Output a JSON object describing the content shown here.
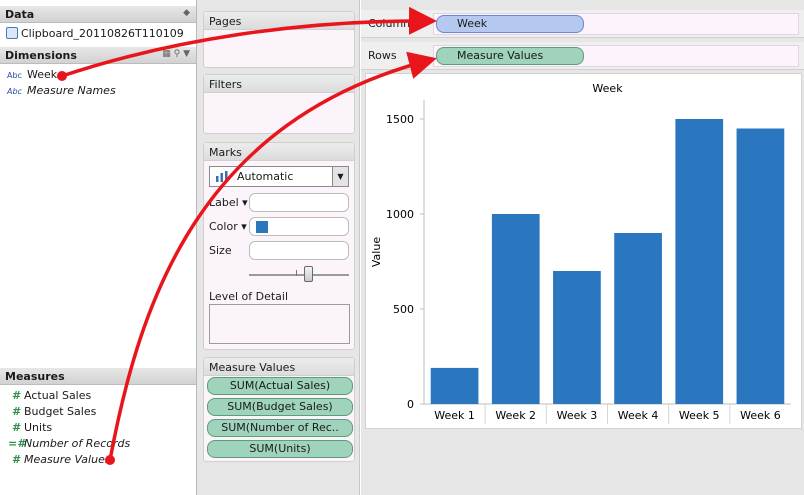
{
  "data_pane": {
    "title": "Data",
    "source_name": "Clipboard_20110826T110109",
    "dimensions_title": "Dimensions",
    "dimensions": [
      {
        "type": "Abc",
        "name": "Week",
        "italic": false
      },
      {
        "type": "Abc",
        "name": "Measure Names",
        "italic": true
      }
    ],
    "measures_title": "Measures",
    "measures": [
      {
        "type": "#",
        "name": "Actual Sales",
        "italic": false
      },
      {
        "type": "#",
        "name": "Budget Sales",
        "italic": false
      },
      {
        "type": "#",
        "name": "Units",
        "italic": false
      },
      {
        "type": "=#",
        "name": "Number of Records",
        "italic": true
      },
      {
        "type": "#",
        "name": "Measure Values",
        "italic": true
      }
    ]
  },
  "shelves": {
    "pages_title": "Pages",
    "filters_title": "Filters",
    "marks_title": "Marks",
    "mark_type": "Automatic",
    "label_label": "Label",
    "color_label": "Color",
    "size_label": "Size",
    "detail_label": "Level of Detail",
    "measure_values_title": "Measure Values",
    "measure_values": [
      "SUM(Actual Sales)",
      "SUM(Budget Sales)",
      "SUM(Number of Rec..",
      "SUM(Units)"
    ],
    "columns_label": "Columns",
    "columns_pill": "Week",
    "rows_label": "Rows",
    "rows_pill": "Measure Values"
  },
  "colors": {
    "bar": "#2a77c0",
    "arrow": "#e8161b",
    "pill_green": "#9fd3bc",
    "pill_blue": "#b4c8f0"
  },
  "size_slider_level": 0.6,
  "chart_data": {
    "type": "bar",
    "title": "Week",
    "xlabel": "",
    "ylabel": "Value",
    "categories": [
      "Week 1",
      "Week 2",
      "Week 3",
      "Week 4",
      "Week 5",
      "Week 6"
    ],
    "values": [
      190,
      1000,
      700,
      900,
      1500,
      1450
    ],
    "ylim": [
      0,
      1600
    ],
    "yticks": [
      0,
      500,
      1000,
      1500
    ],
    "grid": false
  }
}
